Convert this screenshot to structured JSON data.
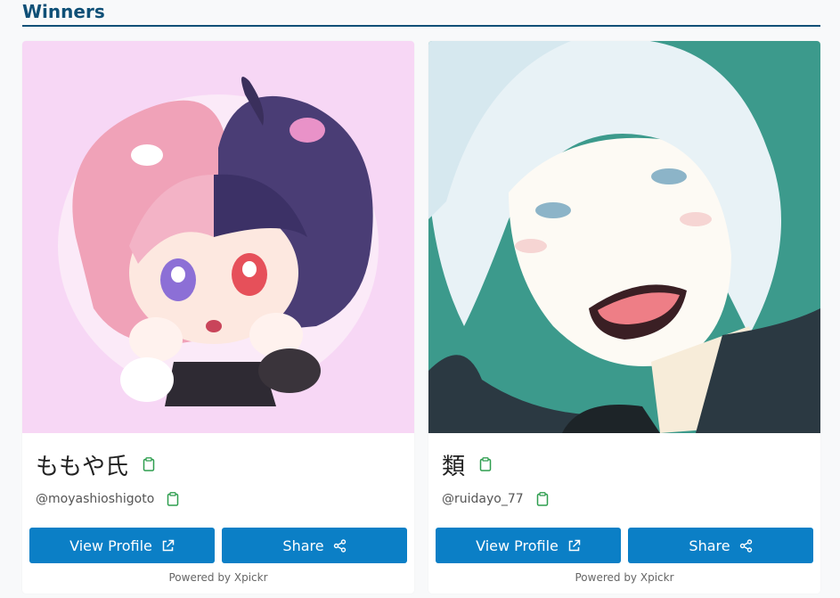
{
  "section": {
    "title": "Winners"
  },
  "winners": [
    {
      "display_name": "ももや氏",
      "handle": "@moyashioshigoto",
      "art_background": "#f7d7f5",
      "view_label": "View Profile",
      "share_label": "Share",
      "powered_by": "Powered by Xpickr"
    },
    {
      "display_name": "類",
      "handle": "@ruidayo_77",
      "art_background": "#3c9a8c",
      "view_label": "View Profile",
      "share_label": "Share",
      "powered_by": "Powered by Xpickr"
    }
  ],
  "colors": {
    "accent": "#0b7fc6",
    "title": "#0f5077",
    "copy_icon": "#2e9e4f"
  }
}
